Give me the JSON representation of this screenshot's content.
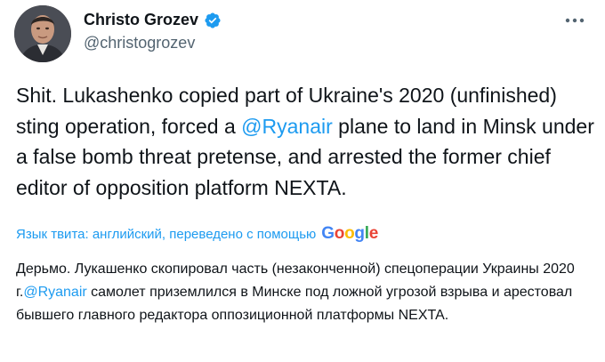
{
  "author": {
    "name": "Christo Grozev",
    "handle": "@christogrozev",
    "verified": true,
    "avatar_icon": "profile-photo"
  },
  "menu_icon": "more-horizontal-icon",
  "tweet": {
    "text_part1": "Shit. Lukashenko copied part of Ukraine's 2020 (unfinished) sting operation, forced a ",
    "mention": "@Ryanair",
    "text_part2": " plane to land in Minsk under a false bomb threat pretense, and arrested the former chief editor of opposition platform NEXTA."
  },
  "translation": {
    "label": "Язык твита: английский, переведено с помощью",
    "provider": "Google",
    "text_part1": "Дерьмо. Лукашенко скопировал часть (незаконченной) спецоперации Украины 2020 г.",
    "mention": "@Ryanair",
    "text_part2": " самолет приземлился в Минске под ложной угрозой взрыва и арестовал бывшего главного редактора оппозиционной платформы NEXTA."
  },
  "colors": {
    "link": "#1d9bf0",
    "text": "#0f1419",
    "secondary": "#536471",
    "google_blue": "#4285F4",
    "google_red": "#EA4335",
    "google_yellow": "#FBBC05",
    "google_green": "#34A853"
  }
}
